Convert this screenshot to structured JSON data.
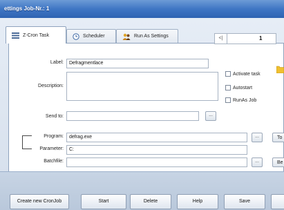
{
  "window": {
    "title": "ettings Job-Nr.: 1"
  },
  "tabs": [
    {
      "label": "Z-Cron Task",
      "icon": "list-icon"
    },
    {
      "label": "Scheduler",
      "icon": "clock-icon"
    },
    {
      "label": "Run As Settings",
      "icon": "users-icon"
    }
  ],
  "form": {
    "label_label": "Label:",
    "label_value": "Defragmentlace",
    "description_label": "Description:",
    "description_value": "",
    "sendto_label": "Send to:",
    "sendto_value": "",
    "program_label": "Program:",
    "program_value": "defrag.exe",
    "parameter_label": "Parameter:",
    "parameter_value": "C:",
    "batchfile_label": "Batchfile:",
    "batchfile_value": "",
    "browse_label": "...",
    "program_side_btn": "To",
    "batchfile_side_btn": "Be"
  },
  "spinner": {
    "arrow": "<|",
    "value": "1"
  },
  "checks": {
    "activate": "Activate task",
    "autostart": "Autostart",
    "runas": "RunAs Job"
  },
  "buttons": {
    "create": "Create new CronJob",
    "start": "Start",
    "delete": "Delete",
    "help": "Help",
    "save": "Save"
  }
}
